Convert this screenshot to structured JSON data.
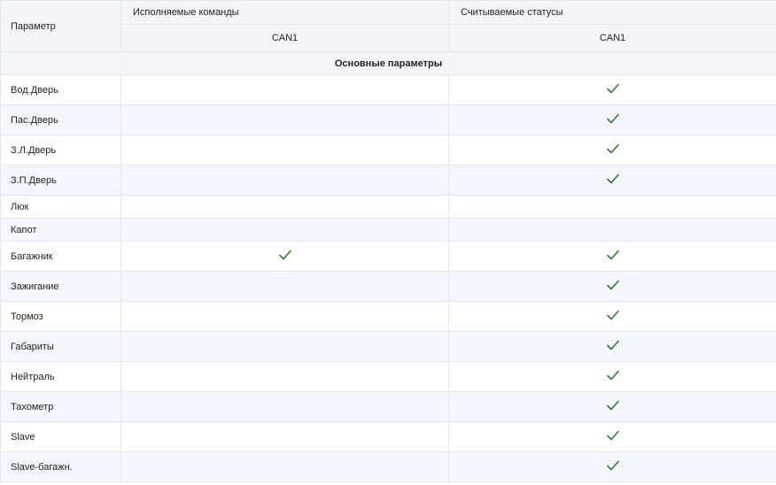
{
  "table": {
    "header": {
      "param_label": "Параметр",
      "commands_label": "Исполняемые команды",
      "statuses_label": "Считываемые статусы",
      "commands_sub": "CAN1",
      "statuses_sub": "CAN1"
    },
    "section_title": "Основные параметры",
    "check_icon": "check-icon",
    "check_color": "#2e7d32",
    "rows": [
      {
        "label": "Вод.Дверь",
        "command": false,
        "status": true
      },
      {
        "label": "Пас.Дверь",
        "command": false,
        "status": true
      },
      {
        "label": "З.Л.Дверь",
        "command": false,
        "status": true
      },
      {
        "label": "З.П.Дверь",
        "command": false,
        "status": true
      },
      {
        "label": "Люк",
        "command": false,
        "status": false
      },
      {
        "label": "Капот",
        "command": false,
        "status": false
      },
      {
        "label": "Багажник",
        "command": true,
        "status": true
      },
      {
        "label": "Зажигание",
        "command": false,
        "status": true
      },
      {
        "label": "Тормоз",
        "command": false,
        "status": true
      },
      {
        "label": "Габариты",
        "command": false,
        "status": true
      },
      {
        "label": "Нейтраль",
        "command": false,
        "status": true
      },
      {
        "label": "Тахометр",
        "command": false,
        "status": true
      },
      {
        "label": "Slave",
        "command": false,
        "status": true
      },
      {
        "label": "Slave-багажн.",
        "command": false,
        "status": true
      }
    ]
  }
}
